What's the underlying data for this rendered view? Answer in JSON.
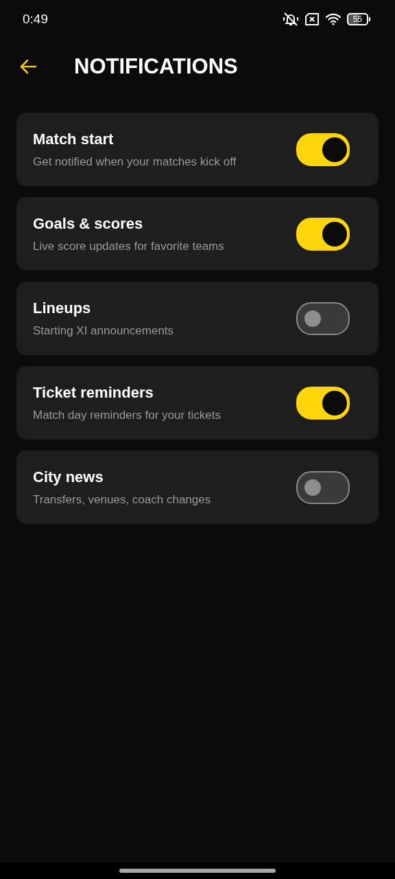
{
  "status_bar": {
    "time": "0:49",
    "battery": "55"
  },
  "header": {
    "title": "NOTIFICATIONS"
  },
  "settings": [
    {
      "title": "Match start",
      "subtitle": "Get notified when your matches kick off",
      "on": true
    },
    {
      "title": "Goals & scores",
      "subtitle": "Live score updates for favorite teams",
      "on": true
    },
    {
      "title": "Lineups",
      "subtitle": "Starting XI announcements",
      "on": false
    },
    {
      "title": "Ticket reminders",
      "subtitle": "Match day reminders for your tickets",
      "on": true
    },
    {
      "title": "City news",
      "subtitle": "Transfers, venues, coach changes",
      "on": false
    }
  ]
}
